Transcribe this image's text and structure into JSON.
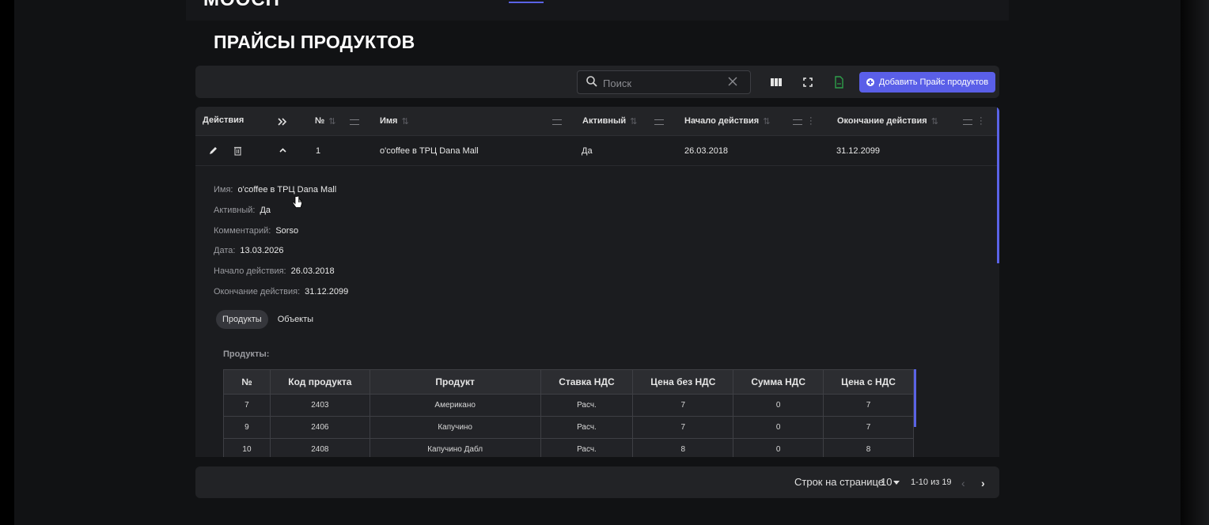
{
  "app": {
    "logo": "MOOCH"
  },
  "page": {
    "title": "ПРАЙСЫ ПРОДУКТОВ"
  },
  "toolbar": {
    "search_placeholder": "Поиск",
    "add_button_label": "Добавить Прайс продуктов",
    "icons": [
      "search-icon",
      "clear-icon",
      "columns-icon",
      "fullscreen-icon",
      "export-csv-icon",
      "add-circle-icon"
    ],
    "colors": {
      "accent": "#5a5fe8",
      "export_icon": "#2e9e4a"
    }
  },
  "table": {
    "columns": {
      "actions": "Действия",
      "number": "№",
      "name": "Имя",
      "active": "Активный",
      "start": "Начало действия",
      "end": "Окончание действия"
    },
    "rows": [
      {
        "number": "1",
        "name": "o'coffee в ТРЦ Dana Mall",
        "active": "Да",
        "start": "26.03.2018",
        "end": "31.12.2099"
      }
    ]
  },
  "detail": {
    "fields": [
      {
        "label": "Имя:",
        "value": "o'coffee в ТРЦ Dana Mall"
      },
      {
        "label": "Активный:",
        "value": "Да"
      },
      {
        "label": "Комментарий:",
        "value": "Sorso"
      },
      {
        "label": "Дата:",
        "value": "13.03.2026"
      },
      {
        "label": "Начало действия:",
        "value": "26.03.2018"
      },
      {
        "label": "Окончание действия:",
        "value": "31.12.2099"
      }
    ],
    "tabs": [
      "Продукты",
      "Объекты"
    ],
    "products_title": "Продукты:",
    "products_headers": [
      "№",
      "Код продукта",
      "Продукт",
      "Ставка НДС",
      "Цена без НДС",
      "Сумма НДС",
      "Цена с НДС"
    ],
    "products_rows": [
      [
        "7",
        "2403",
        "Американо",
        "Расч.",
        "7",
        "0",
        "7"
      ],
      [
        "9",
        "2406",
        "Капучино",
        "Расч.",
        "7",
        "0",
        "7"
      ],
      [
        "10",
        "2408",
        "Капучино Дабл",
        "Расч.",
        "8",
        "0",
        "8"
      ]
    ]
  },
  "pagination": {
    "rows_per_page_label": "Строк на странице",
    "rows_per_page": "10",
    "range": "1-10 из 19"
  }
}
